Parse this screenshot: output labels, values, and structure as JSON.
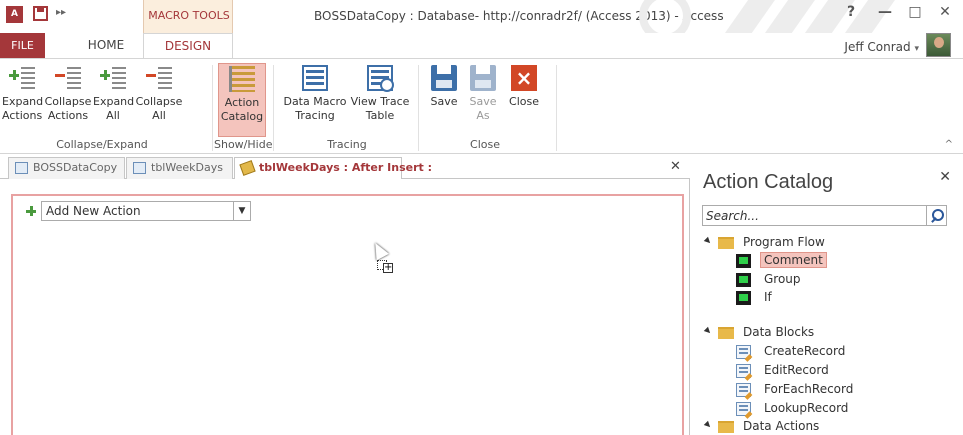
{
  "window": {
    "app_icon": "A",
    "title": "BOSSDataCopy : Database- http://conradr2f/ (Access 2013) - Access",
    "contextual_tools": "MACRO TOOLS",
    "help": "?",
    "minimize": "—",
    "restore": "□",
    "close": "✕",
    "user": "Jeff Conrad",
    "user_caret": "▾"
  },
  "qat": {
    "more": "▸▸"
  },
  "tabs": {
    "file": "FILE",
    "home": "HOME",
    "design": "DESIGN"
  },
  "ribbon": {
    "groups": {
      "collapse_expand": {
        "label": "Collapse/Expand",
        "buttons": [
          {
            "line1": "Expand",
            "line2": "Actions",
            "icon": "expand-actions-icon"
          },
          {
            "line1": "Collapse",
            "line2": "Actions",
            "icon": "collapse-actions-icon"
          },
          {
            "line1": "Expand",
            "line2": "All",
            "icon": "expand-all-icon"
          },
          {
            "line1": "Collapse",
            "line2": "All",
            "icon": "collapse-all-icon"
          }
        ]
      },
      "show_hide": {
        "label": "Show/Hide",
        "buttons": [
          {
            "line1": "Action",
            "line2": "Catalog",
            "icon": "action-catalog-icon",
            "active": true
          }
        ]
      },
      "tracing": {
        "label": "Tracing",
        "buttons": [
          {
            "line1": "Data Macro",
            "line2": "Tracing",
            "icon": "data-macro-tracing-icon"
          },
          {
            "line1": "View Trace",
            "line2": "Table",
            "icon": "view-trace-table-icon"
          }
        ]
      },
      "close": {
        "label": "Close",
        "buttons": [
          {
            "line1": "Save",
            "line2": "",
            "icon": "save-icon"
          },
          {
            "line1": "Save",
            "line2": "As",
            "icon": "save-as-icon",
            "disabled": true
          },
          {
            "line1": "Close",
            "line2": "",
            "icon": "close-macro-icon"
          }
        ]
      }
    },
    "collapse_caret": "^"
  },
  "document_tabs": [
    {
      "label": "BOSSDataCopy",
      "icon": "database-icon"
    },
    {
      "label": "tblWeekDays",
      "icon": "table-icon"
    },
    {
      "label": "tblWeekDays : After Insert :",
      "icon": "data-macro-icon",
      "active": true
    }
  ],
  "document_close": "✕",
  "designer": {
    "add_action": {
      "value": "Add New Action",
      "dropdown": "▼"
    }
  },
  "action_catalog": {
    "title": "Action Catalog",
    "close": "✕",
    "search_placeholder": "Search...",
    "groups": [
      {
        "name": "Program Flow",
        "items": [
          "Comment",
          "Group",
          "If"
        ],
        "selected": "Comment"
      },
      {
        "name": "Data Blocks",
        "items": [
          "CreateRecord",
          "EditRecord",
          "ForEachRecord",
          "LookupRecord"
        ]
      },
      {
        "name": "Data Actions",
        "items": []
      }
    ]
  },
  "colors": {
    "accent": "#a4373a",
    "selection_fill": "#f4c4bd",
    "frame_border": "#e8a2a2"
  }
}
